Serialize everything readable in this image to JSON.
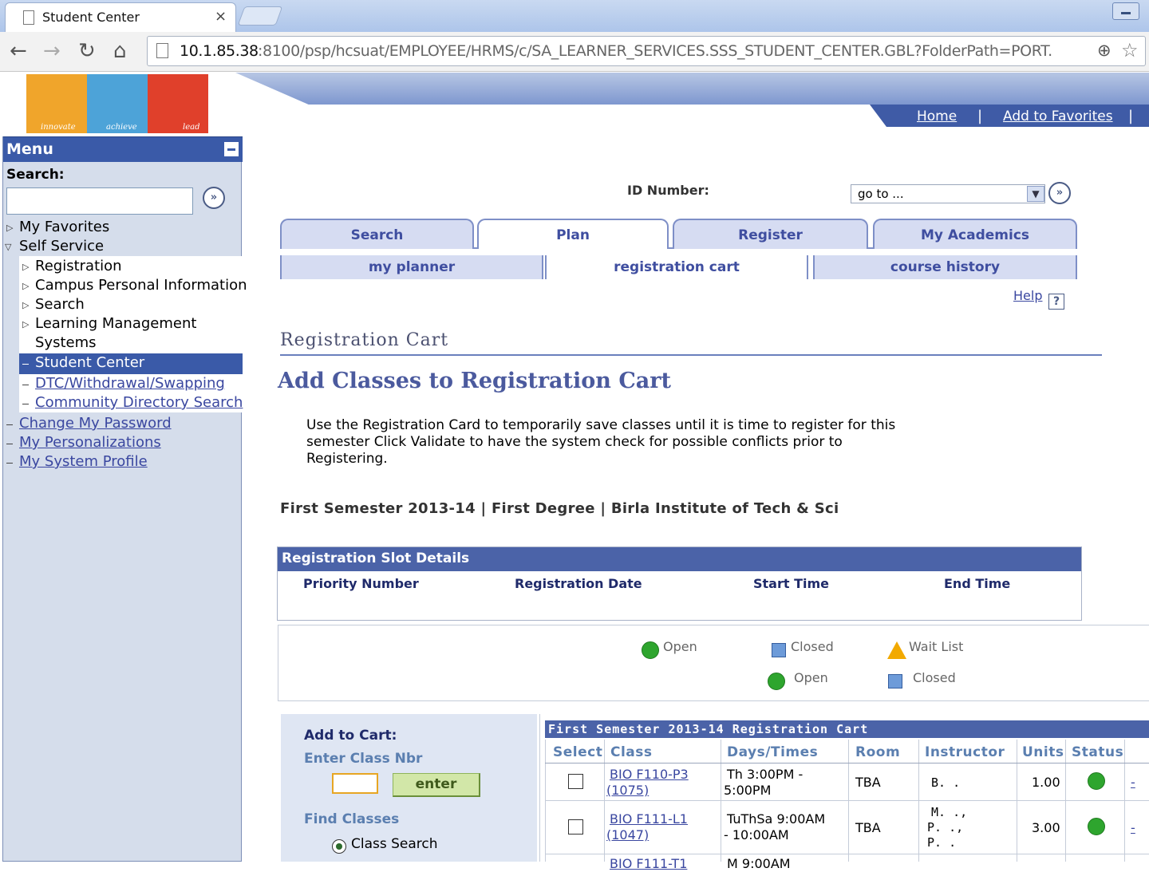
{
  "browser": {
    "tab_title": "Student Center",
    "tab_close": "×",
    "address_host": "10.1.85.38",
    "address_rest": ":8100/psp/hcsuat/EMPLOYEE/HRMS/c/SA_LEARNER_SERVICES.SSS_STUDENT_CENTER.GBL?FolderPath=PORT."
  },
  "banner": {
    "logo_words": [
      "innovate",
      "achieve",
      "lead"
    ],
    "links": [
      "Home",
      "Add to Favorites"
    ]
  },
  "menu": {
    "title": "Menu",
    "search_label": "Search:",
    "items": {
      "favorites": "My Favorites",
      "self_service": "Self Service",
      "registration": "Registration",
      "campus_info": "Campus Personal Information",
      "search": "Search",
      "lms_1": "Learning Management",
      "lms_2": "Systems",
      "student_center": "Student Center",
      "dtc": "DTC/Withdrawal/Swapping",
      "community": "Community Directory Search",
      "change_password": "Change My Password",
      "personalizations": "My Personalizations",
      "system_profile": "My System Profile"
    }
  },
  "header": {
    "id_label": "ID Number:",
    "goto_value": "go to ..."
  },
  "tabs": [
    "Search",
    "Plan",
    "Register",
    "My Academics"
  ],
  "active_tab": "Plan",
  "subtabs": [
    "my planner",
    "registration cart",
    "course history"
  ],
  "active_subtab": "registration cart",
  "help": "Help",
  "page": {
    "title": "Registration Cart",
    "subtitle": "Add Classes to Registration Cart",
    "intro_1": "Use the Registration Card to temporarily save classes until it is time to register for this",
    "intro_2": "semester  Click Validate to have the system check for possible conflicts prior to",
    "intro_3": "Registering.",
    "term": "First Semester 2013-14 | First Degree | Birla Institute of Tech & Sci"
  },
  "slot": {
    "title": "Registration Slot Details",
    "columns": [
      "Priority Number",
      "Registration Date",
      "Start Time",
      "End Time"
    ]
  },
  "legend": {
    "open": "Open",
    "closed": "Closed",
    "wait_list": "Wait List"
  },
  "add_to_cart": {
    "title": "Add to Cart:",
    "enter_label": "Enter Class Nbr",
    "enter_button": "enter",
    "find_label": "Find Classes",
    "radio_label": "Class Search"
  },
  "cart": {
    "title": "First Semester 2013-14 Registration Cart",
    "columns": [
      "Select",
      "Class",
      "Days/Times",
      "Room",
      "Instructor",
      "Units",
      "Status"
    ],
    "rows": [
      {
        "class_1": "BIO F110-P3",
        "class_2": "(1075)",
        "days_1": "Th 3:00PM -",
        "days_2": "5:00PM",
        "room": "TBA",
        "instructor_1": "B. .",
        "instructor_2": "",
        "instructor_3": "",
        "units": "1.00",
        "status": "open",
        "delete": "-"
      },
      {
        "class_1": "BIO F111-L1",
        "class_2": "(1047)",
        "days_1": "TuThSa 9:00AM",
        "days_2": "- 10:00AM",
        "room": "TBA",
        "instructor_1": "M. .,",
        "instructor_2": "P. .,",
        "instructor_3": "P. .",
        "units": "3.00",
        "status": "open",
        "delete": "-"
      },
      {
        "class_1": "BIO F111-T1",
        "days_1": "M 9:00AM"
      }
    ]
  },
  "colors": {
    "nav_blue": "#3a5aa8",
    "tab_blue": "#7e8fc7",
    "open_green": "#2ea52e",
    "closed_blue": "#6d9bd9",
    "waitlist_yellow": "#f2a900"
  }
}
